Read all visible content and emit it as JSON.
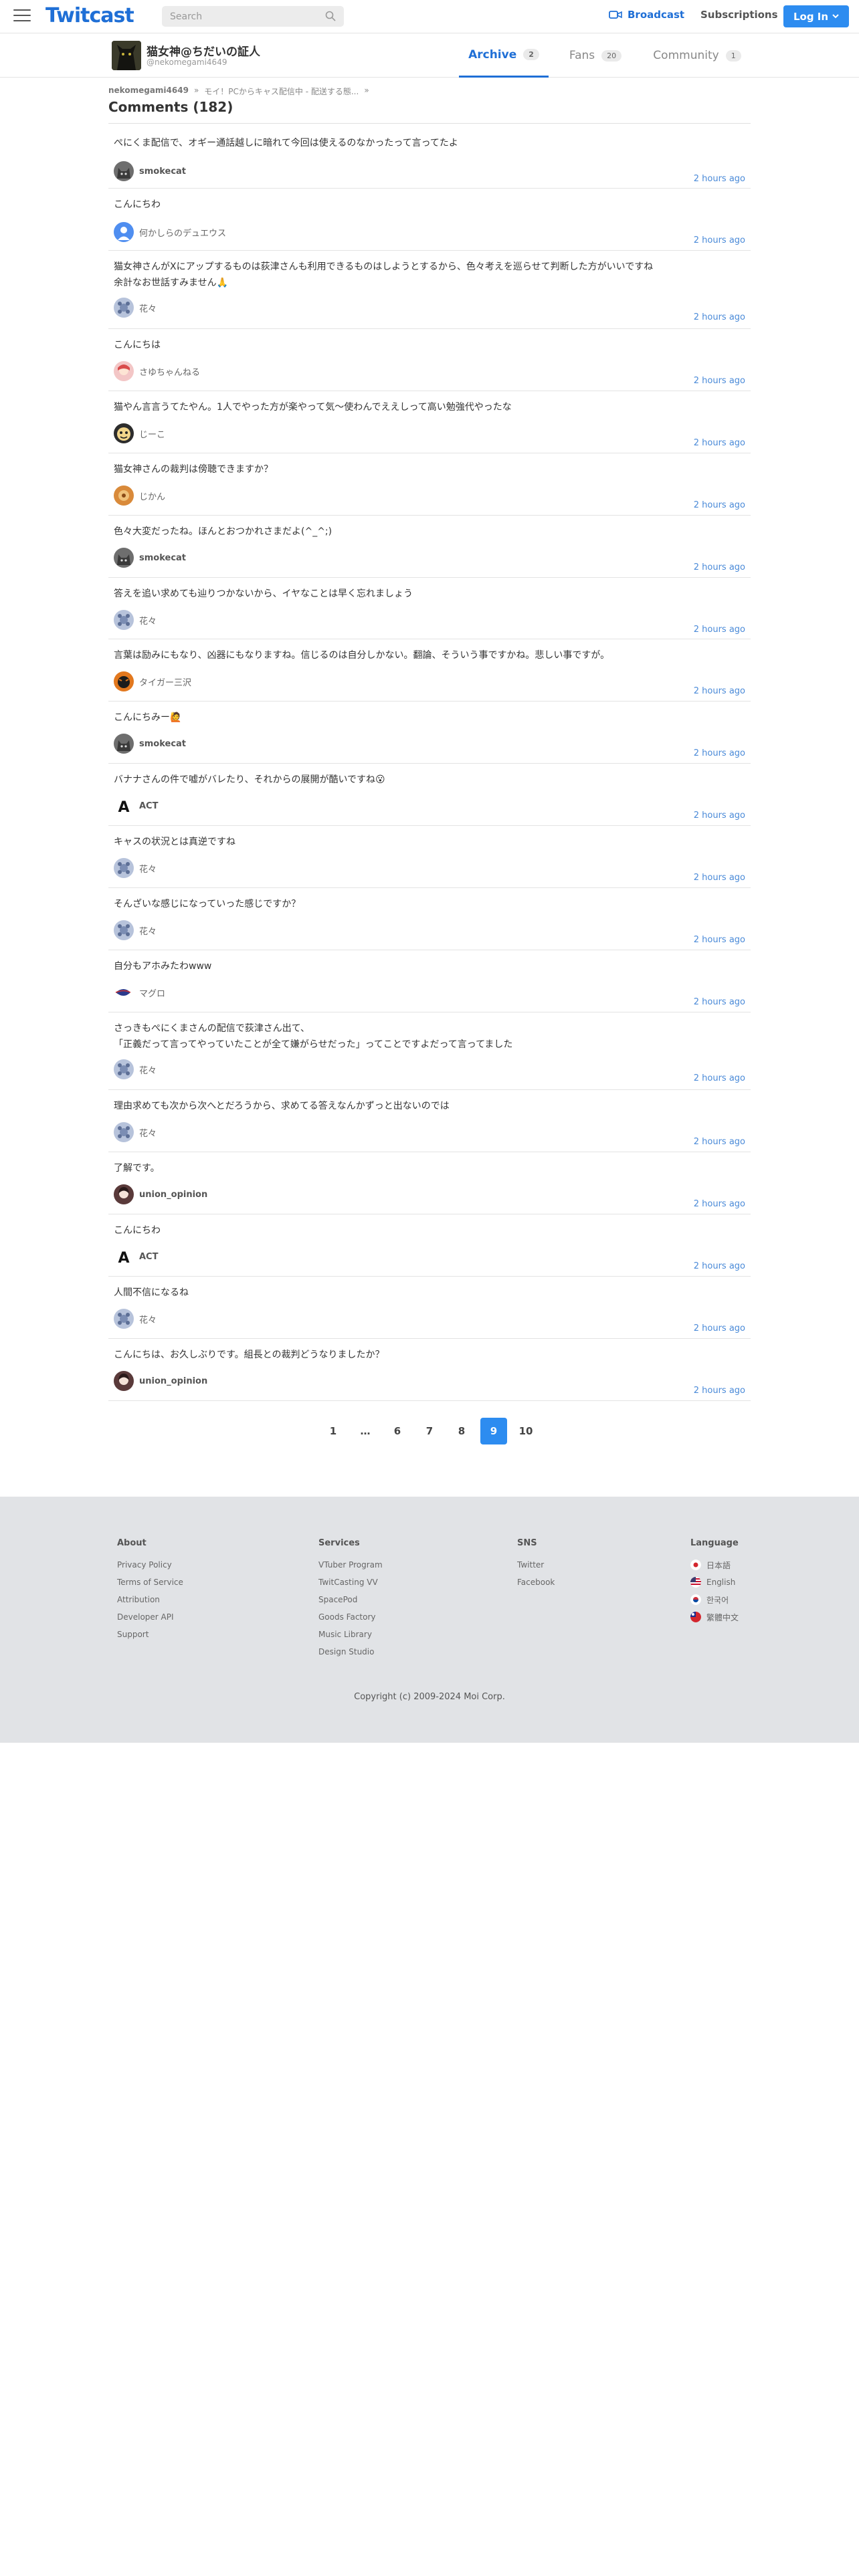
{
  "header": {
    "logo": "Twitcast",
    "search_placeholder": "Search",
    "broadcast_label": "Broadcast",
    "subscriptions_label": "Subscriptions",
    "login_label": "Log In",
    "accent_color": "#1f6fd6",
    "button_color": "#2d8cf0"
  },
  "profile": {
    "name": "猫女神@ちだいの証人",
    "handle": "@nekomegami4649",
    "tabs": [
      {
        "label": "Archive",
        "count": "2",
        "active": true
      },
      {
        "label": "Fans",
        "count": "20",
        "active": false
      },
      {
        "label": "Community",
        "count": "1",
        "active": false
      }
    ]
  },
  "breadcrumb": {
    "user": "nekomegami4649",
    "sep": "»",
    "title": "モイ！PCからキャス配信中 - 配送する態..."
  },
  "comments_title": "Comments (182)",
  "comments": [
    {
      "text": "ぺにくま配信で、オギー通話越しに暗れて今回は使えるのなかったって言ってたよ",
      "user": "smokecat",
      "time": "2 hours ago",
      "avatar": "cat",
      "bold": true
    },
    {
      "text": "こんにちわ",
      "user": "何かしらのデュエウス",
      "time": "2 hours ago",
      "avatar": "person",
      "bold": false
    },
    {
      "text": "猫女神さんがXにアップするものは荻津さんも利用できるものはしようとするから、色々考えを巡らせて判断した方がいいですね\n余計なお世話すみません🙏",
      "user": "花々",
      "time": "2 hours ago",
      "avatar": "flower",
      "bold": false
    },
    {
      "text": "こんにちは",
      "user": "さゆちゃんねる",
      "time": "2 hours ago",
      "avatar": "girl",
      "bold": false
    },
    {
      "text": "猫やん言言うてたやん。1人でやった方が楽やって気〜使わんでええしって高い勉強代やったな",
      "user": "じーこ",
      "time": "2 hours ago",
      "avatar": "face",
      "bold": false
    },
    {
      "text": "猫女神さんの裁判は傍聴できますか？",
      "user": "じかん",
      "time": "2 hours ago",
      "avatar": "orange",
      "bold": false
    },
    {
      "text": "色々大変だったね。ほんとおつかれさまだよ(^_^;)",
      "user": "smokecat",
      "time": "2 hours ago",
      "avatar": "cat",
      "bold": true
    },
    {
      "text": "答えを追い求めても辿りつかないから、イヤなことは早く忘れましょう",
      "user": "花々",
      "time": "2 hours ago",
      "avatar": "flower",
      "bold": false
    },
    {
      "text": "言葉は励みにもなり、凶器にもなりますね。信じるのは自分しかない。翻論、そういう事ですかね。悲しい事ですが。",
      "user": "タイガー三沢",
      "time": "2 hours ago",
      "avatar": "tiger",
      "bold": false
    },
    {
      "text": "こんにちみー🙋",
      "user": "smokecat",
      "time": "2 hours ago",
      "avatar": "cat",
      "bold": true
    },
    {
      "text": "バナナさんの件で嘘がバレたり、それからの展開が酷いですね😮",
      "user": "ACT",
      "time": "2 hours ago",
      "avatar": "letterA",
      "bold": true
    },
    {
      "text": "キャスの状況とは真逆ですね",
      "user": "花々",
      "time": "2 hours ago",
      "avatar": "flower",
      "bold": false
    },
    {
      "text": "そんざいな感じになっていった感じですか？",
      "user": "花々",
      "time": "2 hours ago",
      "avatar": "flower",
      "bold": false
    },
    {
      "text": "自分もアホみたわwww",
      "user": "マグロ",
      "time": "2 hours ago",
      "avatar": "fish",
      "bold": false
    },
    {
      "text": "さっきもぺにくまさんの配信で荻津さん出て、\n「正義だって言ってやっていたことが全て嫌がらせだった」ってことですよだって言ってました",
      "user": "花々",
      "time": "2 hours ago",
      "avatar": "flower",
      "bold": false
    },
    {
      "text": "理由求めても次から次へとだろうから、求めてる答えなんかずっと出ないのでは",
      "user": "花々",
      "time": "2 hours ago",
      "avatar": "flower",
      "bold": false
    },
    {
      "text": "了解です。",
      "user": "union_opinion",
      "time": "2 hours ago",
      "avatar": "woman",
      "bold": true
    },
    {
      "text": "こんにちわ",
      "user": "ACT",
      "time": "2 hours ago",
      "avatar": "letterA",
      "bold": true
    },
    {
      "text": "人間不信になるね",
      "user": "花々",
      "time": "2 hours ago",
      "avatar": "flower",
      "bold": false
    },
    {
      "text": "こんにちは、お久しぶりです。組長との裁判どうなりましたか？",
      "user": "union_opinion",
      "time": "2 hours ago",
      "avatar": "woman",
      "bold": true
    }
  ],
  "pagination": [
    "1",
    "…",
    "6",
    "7",
    "8",
    "9",
    "10"
  ],
  "pagination_active": "9",
  "footer": {
    "about": {
      "heading": "About",
      "links": [
        "Privacy Policy",
        "Terms of Service",
        "Attribution",
        "Developer API",
        "Support"
      ]
    },
    "services": {
      "heading": "Services",
      "links": [
        "VTuber Program",
        "TwitCasting VV",
        "SpacePod",
        "Goods Factory",
        "Music Library",
        "Design Studio"
      ]
    },
    "sns": {
      "heading": "SNS",
      "links": [
        "Twitter",
        "Facebook"
      ]
    },
    "language": {
      "heading": "Language",
      "links": [
        "日本語",
        "English",
        "한국어",
        "繁體中文"
      ]
    },
    "copyright": "Copyright (c) 2009-2024 Moi Corp."
  }
}
